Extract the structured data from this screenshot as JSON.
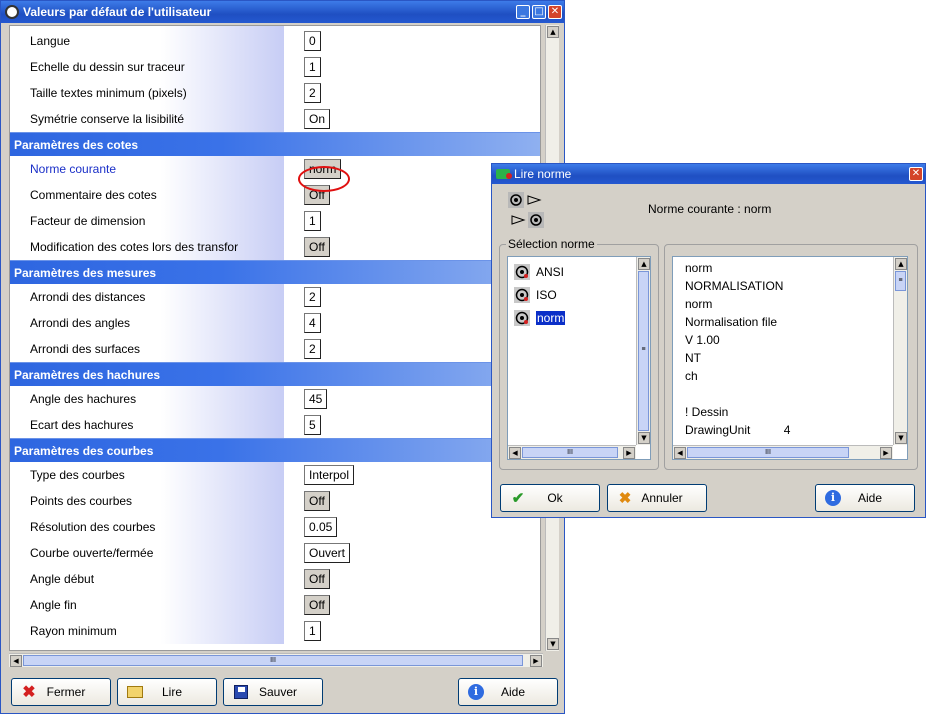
{
  "main": {
    "title": "Valeurs par défaut de l'utilisateur",
    "rows_top": [
      {
        "label": "Langue",
        "value": "0",
        "style": "white"
      },
      {
        "label": "Echelle du dessin sur traceur",
        "value": "1",
        "style": "white"
      },
      {
        "label": "Taille textes minimum (pixels)",
        "value": "2",
        "style": "white"
      },
      {
        "label": "Symétrie conserve la lisibilité",
        "value": "On",
        "style": "white"
      }
    ],
    "sections": [
      {
        "title": "Paramètres des cotes",
        "rows": [
          {
            "label": "Norme courante",
            "value": "norm",
            "style": "gray",
            "current": true
          },
          {
            "label": "Commentaire des cotes",
            "value": "Off",
            "style": "gray"
          },
          {
            "label": "Facteur de dimension",
            "value": "1",
            "style": "white"
          },
          {
            "label": "Modification des cotes lors des transfor",
            "value": "Off",
            "style": "gray"
          }
        ]
      },
      {
        "title": "Paramètres des mesures",
        "rows": [
          {
            "label": "Arrondi des distances",
            "value": "2",
            "style": "white"
          },
          {
            "label": "Arrondi des angles",
            "value": "4",
            "style": "white"
          },
          {
            "label": "Arrondi des surfaces",
            "value": "2",
            "style": "white"
          }
        ]
      },
      {
        "title": "Paramètres des hachures",
        "rows": [
          {
            "label": "Angle des hachures",
            "value": "45",
            "style": "white"
          },
          {
            "label": "Ecart des hachures",
            "value": "5",
            "style": "white"
          }
        ]
      },
      {
        "title": "Paramètres des courbes",
        "rows": [
          {
            "label": "Type des courbes",
            "value": "Interpol",
            "style": "white"
          },
          {
            "label": "Points des courbes",
            "value": "Off",
            "style": "gray"
          },
          {
            "label": "Résolution des courbes",
            "value": "0.05",
            "style": "white"
          },
          {
            "label": "Courbe ouverte/fermée",
            "value": "Ouvert",
            "style": "white"
          },
          {
            "label": "Angle début",
            "value": "Off",
            "style": "gray"
          },
          {
            "label": "Angle fin",
            "value": "Off",
            "style": "gray"
          },
          {
            "label": "Rayon minimum",
            "value": "1",
            "style": "white"
          }
        ]
      }
    ],
    "buttons": {
      "fermer": "Fermer",
      "lire": "Lire",
      "sauver": "Sauver",
      "aide": "Aide"
    }
  },
  "dialog": {
    "title": "Lire norme",
    "current_label": "Norme courante : norm",
    "group_label": "Sélection norme",
    "norms": [
      "ANSI",
      "ISO",
      "norm"
    ],
    "selected_norm": "norm",
    "file_lines": [
      "norm",
      "NORMALISATION",
      "norm",
      "Normalisation file",
      "V 1.00",
      "NT",
      "ch",
      "",
      "! Dessin",
      "DrawingUnit          4"
    ],
    "buttons": {
      "ok": "Ok",
      "annuler": "Annuler",
      "aide": "Aide"
    }
  },
  "colors": {
    "titlebar": "#2458d0",
    "section": "#2e66e0",
    "selection": "#0b2fc8",
    "highlight_circle": "#e01010"
  }
}
